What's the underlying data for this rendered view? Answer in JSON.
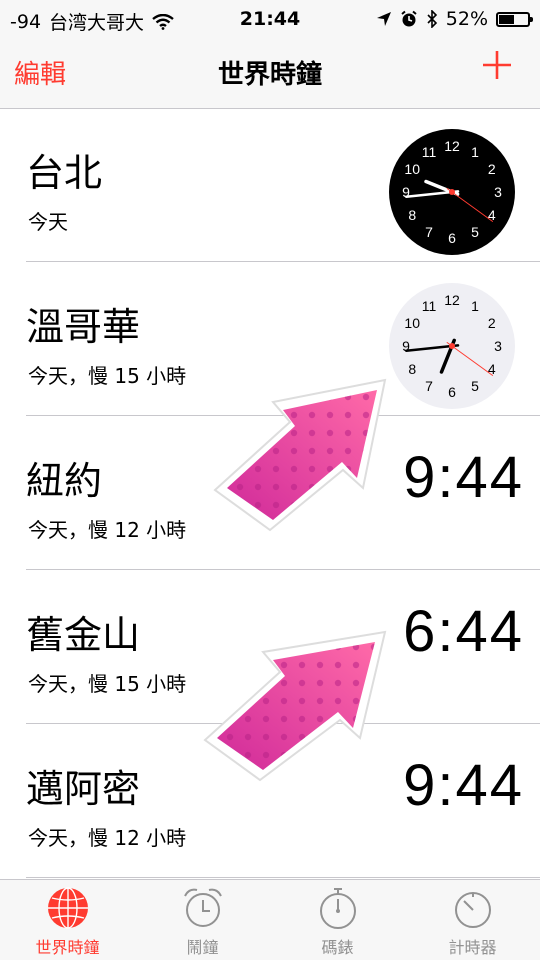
{
  "status_bar": {
    "signal": "-94",
    "carrier": "台湾大哥大",
    "time": "21:44",
    "battery_percent": "52%",
    "battery_level": 0.52
  },
  "nav": {
    "edit_label": "編輯",
    "title": "世界時鐘",
    "add_label": "+"
  },
  "clocks": [
    {
      "city": "台北",
      "offset": "今天",
      "display": "analog-dark",
      "hour": 9,
      "minute": 44,
      "second": 21
    },
    {
      "city": "溫哥華",
      "offset": "今天，慢 15 小時",
      "display": "analog-light",
      "hour": 6,
      "minute": 44,
      "second": 21
    },
    {
      "city": "紐約",
      "offset": "今天，慢 12 小時",
      "display": "digital",
      "time": "9:44"
    },
    {
      "city": "舊金山",
      "offset": "今天，慢 15 小時",
      "display": "digital",
      "time": "6:44"
    },
    {
      "city": "邁阿密",
      "offset": "今天，慢 12 小時",
      "display": "digital",
      "time": "9:44"
    }
  ],
  "tabs": [
    {
      "label": "世界時鐘",
      "icon": "globe-icon",
      "active": true
    },
    {
      "label": "鬧鐘",
      "icon": "alarm-clock-icon",
      "active": false
    },
    {
      "label": "碼錶",
      "icon": "stopwatch-icon",
      "active": false
    },
    {
      "label": "計時器",
      "icon": "timer-icon",
      "active": false
    }
  ],
  "colors": {
    "accent": "#ff3b30",
    "arrow_pink": "#e63aa0"
  }
}
